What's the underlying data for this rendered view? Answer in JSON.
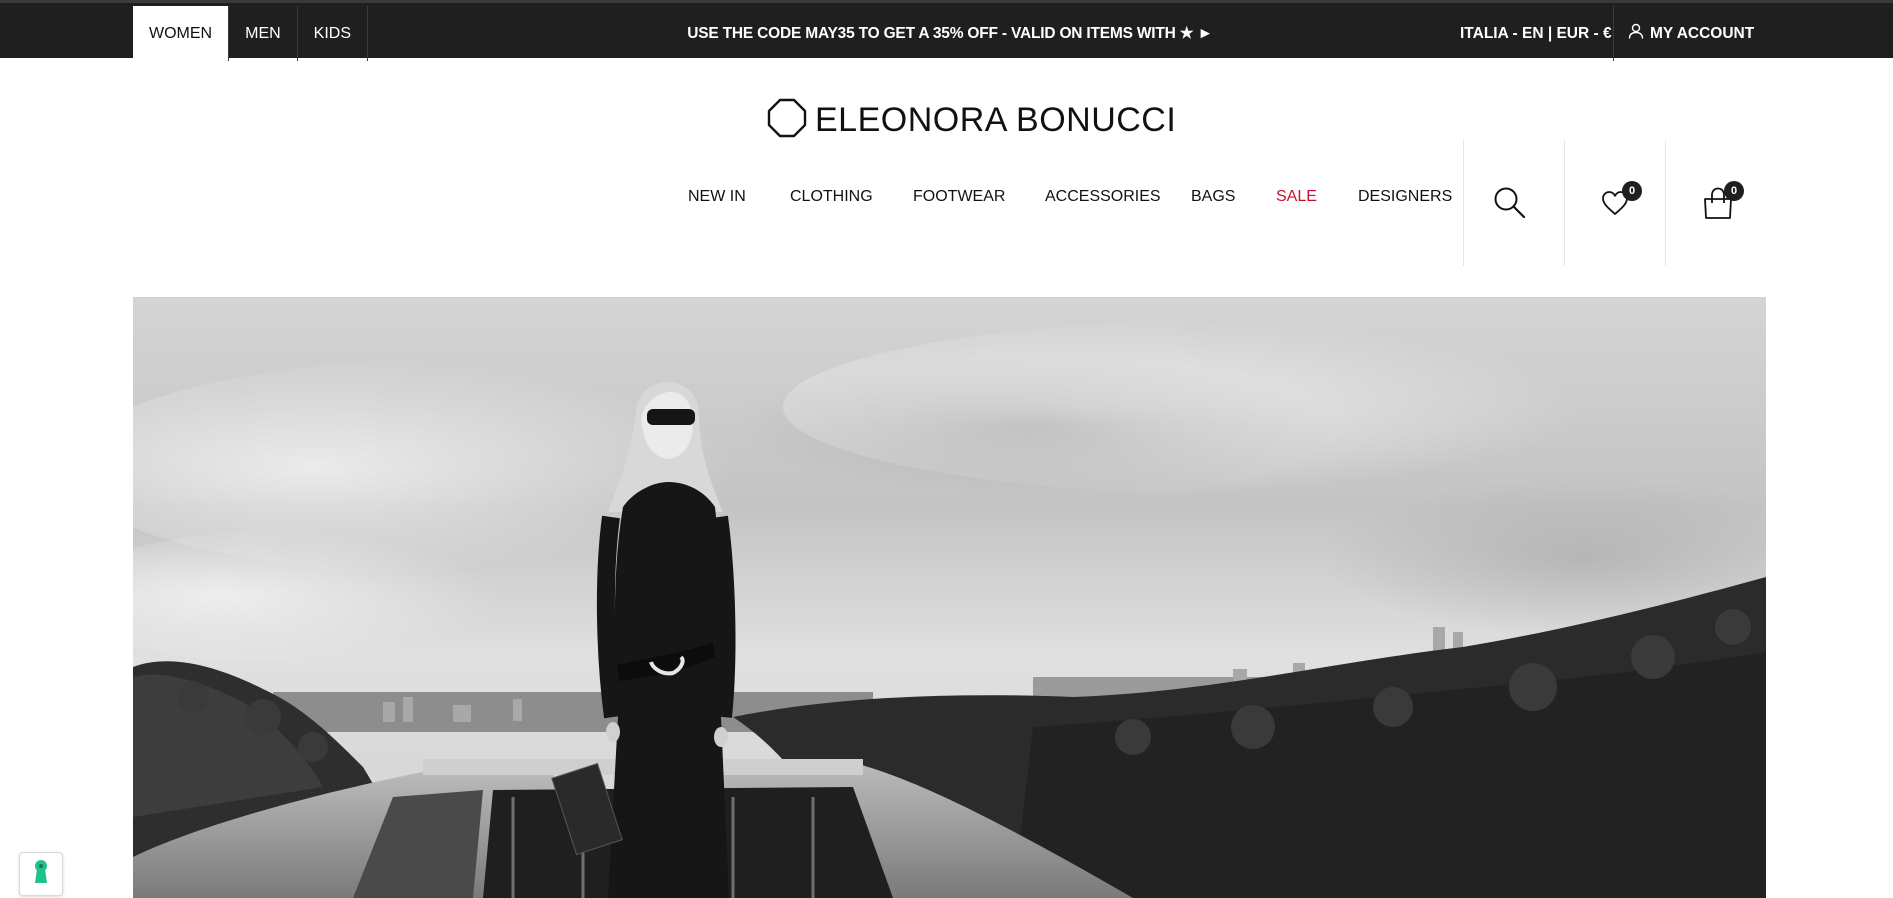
{
  "topbar": {
    "gender_tabs": [
      {
        "label": "WOMEN",
        "active": true
      },
      {
        "label": "MEN",
        "active": false
      },
      {
        "label": "KIDS",
        "active": false
      }
    ],
    "promo_text": "USE THE CODE MAY35 TO GET A 35% OFF - VALID ON ITEMS WITH ★ ►",
    "locale": "ITALIA - EN | EUR - €",
    "account_label": "MY ACCOUNT",
    "colors": {
      "background": "#1f1f1f",
      "text": "#ffffff"
    }
  },
  "brand": {
    "name": "ELEONORA BONUCCI",
    "logo_icon": "octagon-logo-icon"
  },
  "nav": {
    "items": [
      {
        "label": "NEW IN"
      },
      {
        "label": "CLOTHING"
      },
      {
        "label": "FOOTWEAR"
      },
      {
        "label": "ACCESSORIES"
      },
      {
        "label": "BAGS"
      },
      {
        "label": "SALE",
        "highlight": true
      },
      {
        "label": "DESIGNERS"
      }
    ],
    "sale_color": "#c8102e",
    "wishlist_count": "0",
    "cart_count": "0",
    "icons": [
      "search-icon",
      "heart-icon",
      "shopping-bag-icon"
    ]
  },
  "hero": {
    "image": "black-and-white-hero-photo",
    "description_icon": "hero-image"
  },
  "cookie_widget": {
    "icon": "keyhole-icon",
    "color": "#1fc28a"
  }
}
